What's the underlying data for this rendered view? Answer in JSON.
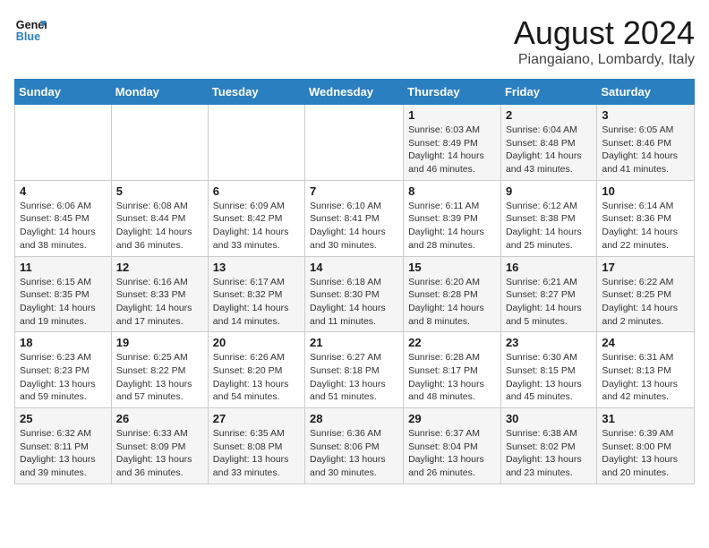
{
  "header": {
    "logo_line1": "General",
    "logo_line2": "Blue",
    "month": "August 2024",
    "location": "Piangaiano, Lombardy, Italy"
  },
  "weekdays": [
    "Sunday",
    "Monday",
    "Tuesday",
    "Wednesday",
    "Thursday",
    "Friday",
    "Saturday"
  ],
  "weeks": [
    [
      {
        "day": "",
        "info": ""
      },
      {
        "day": "",
        "info": ""
      },
      {
        "day": "",
        "info": ""
      },
      {
        "day": "",
        "info": ""
      },
      {
        "day": "1",
        "info": "Sunrise: 6:03 AM\nSunset: 8:49 PM\nDaylight: 14 hours and 46 minutes."
      },
      {
        "day": "2",
        "info": "Sunrise: 6:04 AM\nSunset: 8:48 PM\nDaylight: 14 hours and 43 minutes."
      },
      {
        "day": "3",
        "info": "Sunrise: 6:05 AM\nSunset: 8:46 PM\nDaylight: 14 hours and 41 minutes."
      }
    ],
    [
      {
        "day": "4",
        "info": "Sunrise: 6:06 AM\nSunset: 8:45 PM\nDaylight: 14 hours and 38 minutes."
      },
      {
        "day": "5",
        "info": "Sunrise: 6:08 AM\nSunset: 8:44 PM\nDaylight: 14 hours and 36 minutes."
      },
      {
        "day": "6",
        "info": "Sunrise: 6:09 AM\nSunset: 8:42 PM\nDaylight: 14 hours and 33 minutes."
      },
      {
        "day": "7",
        "info": "Sunrise: 6:10 AM\nSunset: 8:41 PM\nDaylight: 14 hours and 30 minutes."
      },
      {
        "day": "8",
        "info": "Sunrise: 6:11 AM\nSunset: 8:39 PM\nDaylight: 14 hours and 28 minutes."
      },
      {
        "day": "9",
        "info": "Sunrise: 6:12 AM\nSunset: 8:38 PM\nDaylight: 14 hours and 25 minutes."
      },
      {
        "day": "10",
        "info": "Sunrise: 6:14 AM\nSunset: 8:36 PM\nDaylight: 14 hours and 22 minutes."
      }
    ],
    [
      {
        "day": "11",
        "info": "Sunrise: 6:15 AM\nSunset: 8:35 PM\nDaylight: 14 hours and 19 minutes."
      },
      {
        "day": "12",
        "info": "Sunrise: 6:16 AM\nSunset: 8:33 PM\nDaylight: 14 hours and 17 minutes."
      },
      {
        "day": "13",
        "info": "Sunrise: 6:17 AM\nSunset: 8:32 PM\nDaylight: 14 hours and 14 minutes."
      },
      {
        "day": "14",
        "info": "Sunrise: 6:18 AM\nSunset: 8:30 PM\nDaylight: 14 hours and 11 minutes."
      },
      {
        "day": "15",
        "info": "Sunrise: 6:20 AM\nSunset: 8:28 PM\nDaylight: 14 hours and 8 minutes."
      },
      {
        "day": "16",
        "info": "Sunrise: 6:21 AM\nSunset: 8:27 PM\nDaylight: 14 hours and 5 minutes."
      },
      {
        "day": "17",
        "info": "Sunrise: 6:22 AM\nSunset: 8:25 PM\nDaylight: 14 hours and 2 minutes."
      }
    ],
    [
      {
        "day": "18",
        "info": "Sunrise: 6:23 AM\nSunset: 8:23 PM\nDaylight: 13 hours and 59 minutes."
      },
      {
        "day": "19",
        "info": "Sunrise: 6:25 AM\nSunset: 8:22 PM\nDaylight: 13 hours and 57 minutes."
      },
      {
        "day": "20",
        "info": "Sunrise: 6:26 AM\nSunset: 8:20 PM\nDaylight: 13 hours and 54 minutes."
      },
      {
        "day": "21",
        "info": "Sunrise: 6:27 AM\nSunset: 8:18 PM\nDaylight: 13 hours and 51 minutes."
      },
      {
        "day": "22",
        "info": "Sunrise: 6:28 AM\nSunset: 8:17 PM\nDaylight: 13 hours and 48 minutes."
      },
      {
        "day": "23",
        "info": "Sunrise: 6:30 AM\nSunset: 8:15 PM\nDaylight: 13 hours and 45 minutes."
      },
      {
        "day": "24",
        "info": "Sunrise: 6:31 AM\nSunset: 8:13 PM\nDaylight: 13 hours and 42 minutes."
      }
    ],
    [
      {
        "day": "25",
        "info": "Sunrise: 6:32 AM\nSunset: 8:11 PM\nDaylight: 13 hours and 39 minutes."
      },
      {
        "day": "26",
        "info": "Sunrise: 6:33 AM\nSunset: 8:09 PM\nDaylight: 13 hours and 36 minutes."
      },
      {
        "day": "27",
        "info": "Sunrise: 6:35 AM\nSunset: 8:08 PM\nDaylight: 13 hours and 33 minutes."
      },
      {
        "day": "28",
        "info": "Sunrise: 6:36 AM\nSunset: 8:06 PM\nDaylight: 13 hours and 30 minutes."
      },
      {
        "day": "29",
        "info": "Sunrise: 6:37 AM\nSunset: 8:04 PM\nDaylight: 13 hours and 26 minutes."
      },
      {
        "day": "30",
        "info": "Sunrise: 6:38 AM\nSunset: 8:02 PM\nDaylight: 13 hours and 23 minutes."
      },
      {
        "day": "31",
        "info": "Sunrise: 6:39 AM\nSunset: 8:00 PM\nDaylight: 13 hours and 20 minutes."
      }
    ]
  ]
}
